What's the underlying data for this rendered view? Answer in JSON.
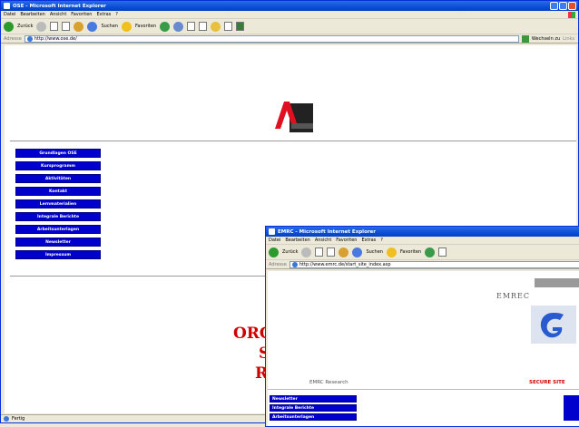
{
  "window1": {
    "title": "OSE - Microsoft Internet Explorer",
    "menu": [
      "Datei",
      "Bearbeiten",
      "Ansicht",
      "Favoriten",
      "Extras",
      "?"
    ],
    "toolbar": {
      "back": "Zurück",
      "search": "Suchen",
      "favorites": "Favoriten"
    },
    "address_label": "Adresse",
    "url": "http://www.ose.de/",
    "go_label": "Wechseln zu",
    "links_label": "Links",
    "nav_items": [
      "Grundlagen OSE",
      "Kursprogramm",
      "Aktivitäten",
      "Kontakt",
      "Lernmaterialien",
      "Integrale Berichte",
      "Arbeitsunterlagen",
      "Newsletter",
      "Impressum"
    ],
    "red_text": [
      "ORG",
      "S",
      "R"
    ],
    "status": "Fertig"
  },
  "window2": {
    "title": "EMRC - Microsoft Internet Explorer",
    "menu": [
      "Datei",
      "Bearbeiten",
      "Ansicht",
      "Favoriten",
      "Extras",
      "?"
    ],
    "toolbar": {
      "back": "Zurück",
      "search": "Suchen",
      "favorites": "Favoriten"
    },
    "address_label": "Adresse",
    "url": "http://www.emrc.de/start_site_index.asp",
    "brand": "EMREC",
    "subtitle": "EMRC Research",
    "tagline": "SECURE SITE",
    "nav_items": [
      "Newsletter",
      "Integrale Berichte",
      "Arbeitsunterlagen"
    ]
  },
  "colors": {
    "titlebar": "#0a4fd6",
    "nav_blue": "#0000cc",
    "red": "#cc0000"
  }
}
